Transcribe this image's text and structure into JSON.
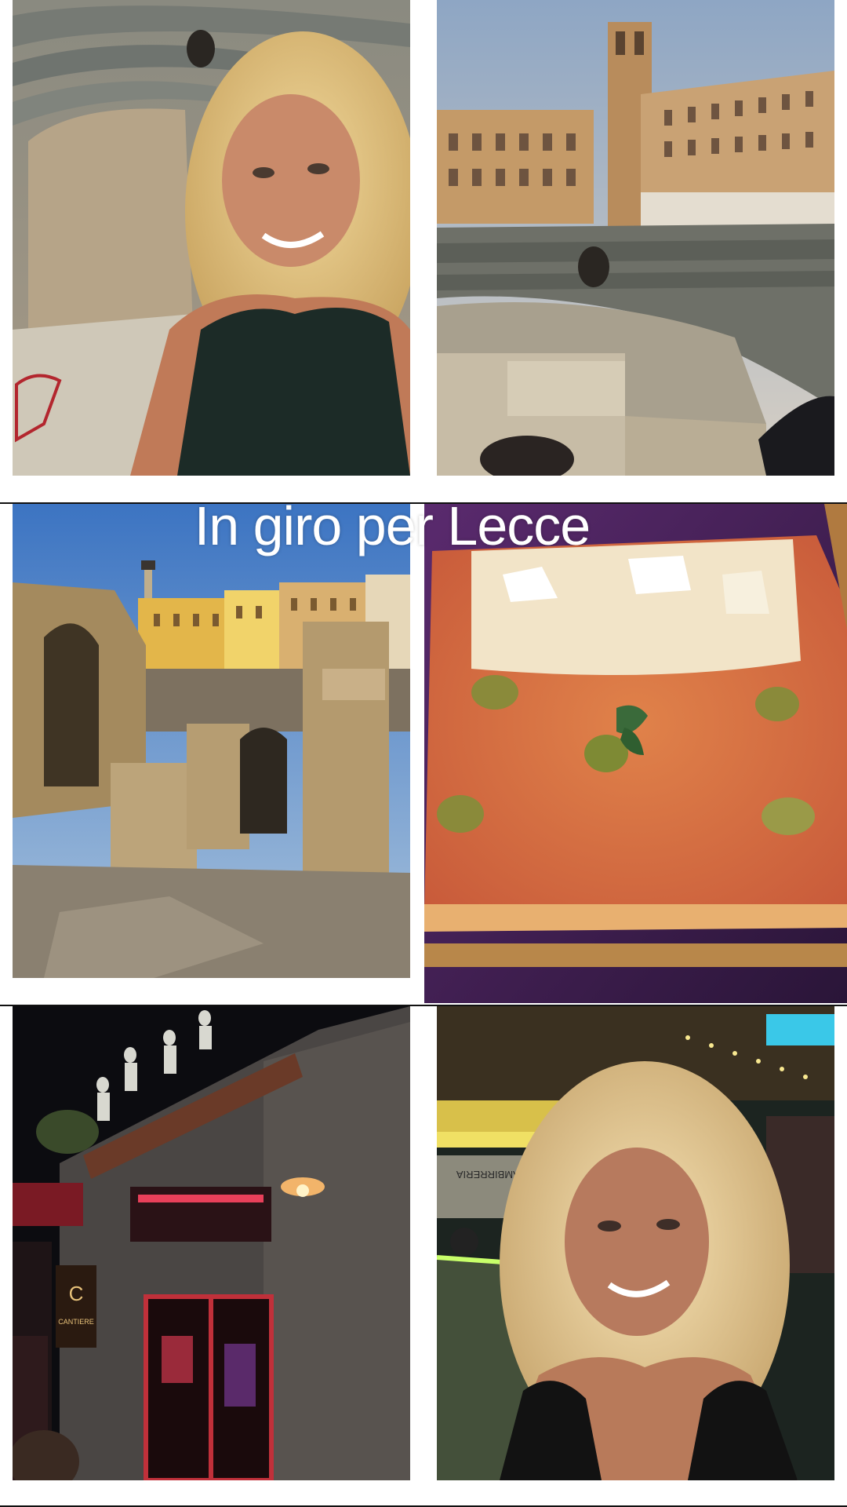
{
  "caption": "In giro per Lecce",
  "tiles": [
    {
      "subject": "selfie in the Roman amphitheatre"
    },
    {
      "subject": "Roman amphitheatre with Piazza Sant'Oronzo buildings"
    },
    {
      "subject": "amphitheatre ruins with column and yellow buildings"
    },
    {
      "subject": "pizza in teglia with olives and basil"
    },
    {
      "subject": "Cantiere bar entrance at night with statues on roof"
    },
    {
      "subject": "selfie at night near Hambirreria"
    }
  ],
  "signs": {
    "cantiere": "CANTIERE",
    "hambirreria": "HAMBIRRERIA"
  },
  "colors": {
    "background": "#ffffff",
    "caption": "#ffffff",
    "divider": "#111111"
  }
}
